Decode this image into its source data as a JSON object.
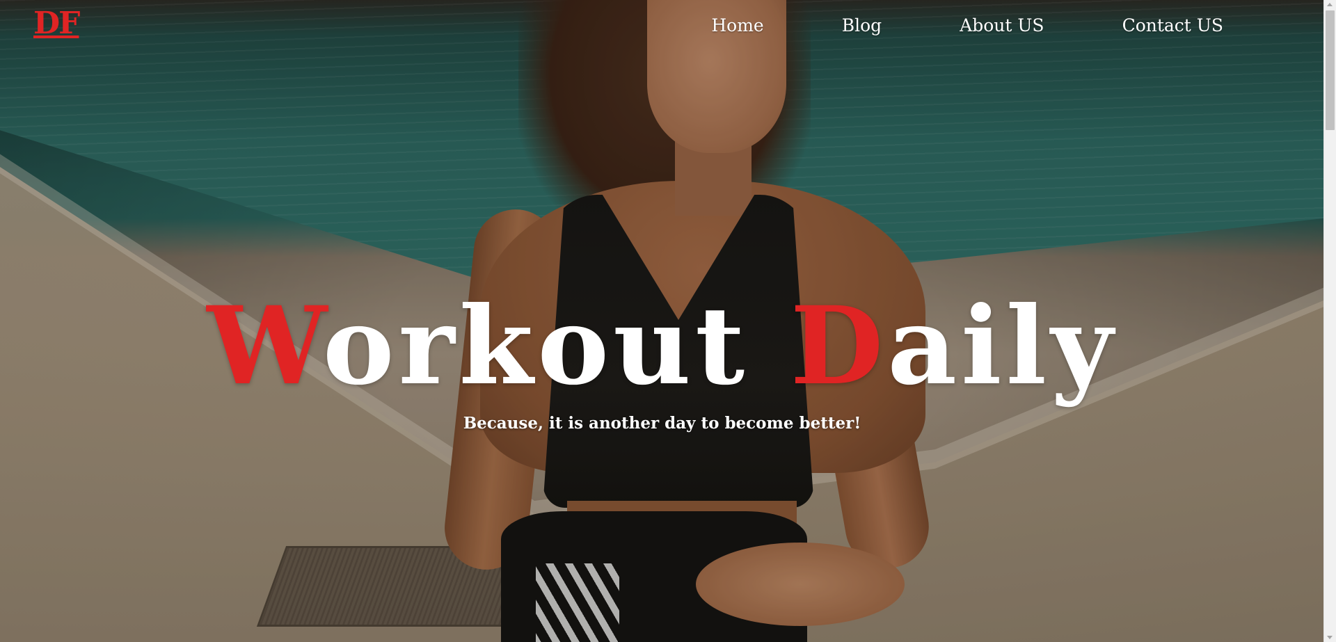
{
  "brand": {
    "logo_text": "DF",
    "accent_color": "#e02424"
  },
  "nav": {
    "items": [
      {
        "label": "Home"
      },
      {
        "label": "Blog"
      },
      {
        "label": "About US"
      },
      {
        "label": "Contact US"
      }
    ]
  },
  "hero": {
    "title_first_initial": "W",
    "title_first_rest": "orkout",
    "title_second_initial": "D",
    "title_second_rest": "aily",
    "subtitle": "Because, it is another day to become better!",
    "background_image": "woman-in-black-sports-top-sitting-on-pier-by-water"
  },
  "scrollbar": {
    "up_icon": "arrow-up-icon",
    "down_icon": "arrow-down-icon"
  }
}
